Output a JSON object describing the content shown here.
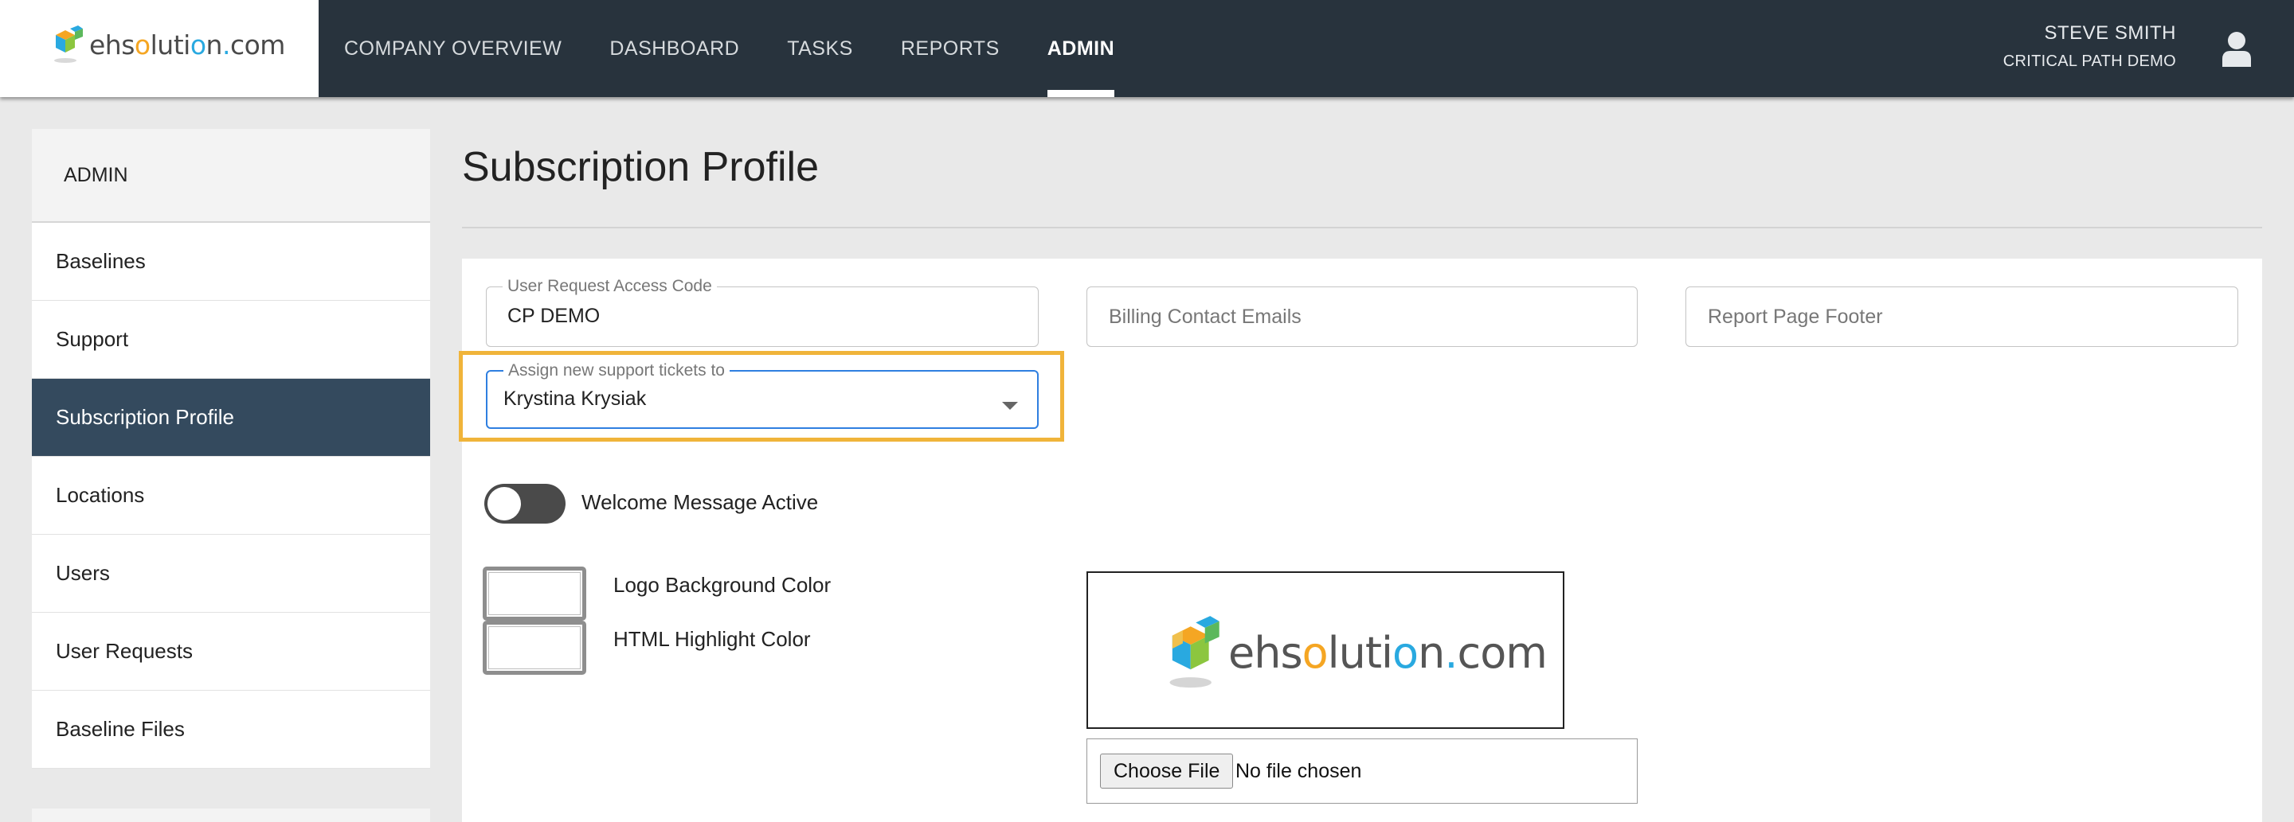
{
  "header": {
    "logo_text_1": "ehs",
    "logo_o1": "o",
    "logo_text_2": "luti",
    "logo_o2": "o",
    "logo_text_3": "n",
    "logo_dot": ".",
    "logo_text_4": "com",
    "nav": [
      {
        "label": "COMPANY OVERVIEW",
        "active": false
      },
      {
        "label": "DASHBOARD",
        "active": false
      },
      {
        "label": "TASKS",
        "active": false
      },
      {
        "label": "REPORTS",
        "active": false
      },
      {
        "label": "ADMIN",
        "active": true
      }
    ],
    "user_name": "STEVE SMITH",
    "user_org": "CRITICAL PATH DEMO",
    "avatar_icon": "user-icon"
  },
  "sidebar": {
    "header": "ADMIN",
    "items": [
      {
        "label": "Baselines",
        "active": false
      },
      {
        "label": "Support",
        "active": false
      },
      {
        "label": "Subscription Profile",
        "active": true
      },
      {
        "label": "Locations",
        "active": false
      },
      {
        "label": "Users",
        "active": false
      },
      {
        "label": "User Requests",
        "active": false
      },
      {
        "label": "Baseline Files",
        "active": false
      }
    ]
  },
  "main": {
    "title": "Subscription Profile",
    "access_code": {
      "label": "User Request Access Code",
      "value": "CP DEMO"
    },
    "billing_emails": {
      "placeholder": "Billing Contact Emails",
      "value": ""
    },
    "report_footer": {
      "placeholder": "Report Page Footer",
      "value": ""
    },
    "support_assignee": {
      "label": "Assign new support tickets to",
      "value": "Krystina Krysiak"
    },
    "welcome_toggle": {
      "label": "Welcome Message Active",
      "on": false
    },
    "logo_bg_color": {
      "label": "Logo Background Color",
      "value": "#ffffff"
    },
    "html_highlight_color": {
      "label": "HTML Highlight Color",
      "value": "#ffffff"
    },
    "file_input": {
      "button_label": "Choose File",
      "status": "No file chosen"
    }
  },
  "colors": {
    "topbar": "#28333d",
    "sidebar_active": "#344a5e",
    "focus_highlight": "#f0b43a",
    "select_focus": "#2f7fe0"
  }
}
